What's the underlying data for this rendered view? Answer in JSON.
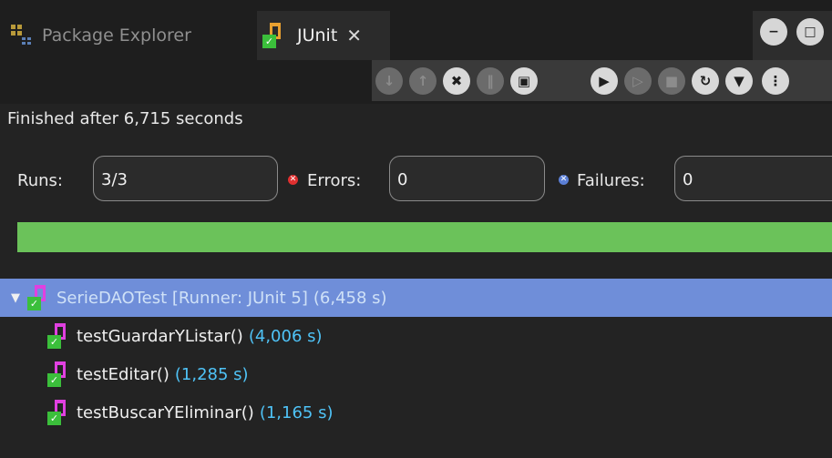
{
  "tabs": [
    {
      "label": "Package Explorer",
      "icon": "package-explorer-icon",
      "active": false
    },
    {
      "label": "JUnit",
      "icon": "junit-icon",
      "active": true,
      "close": "✕"
    }
  ],
  "window_controls": {
    "minimize": "−",
    "maximize": "□"
  },
  "toolbar": [
    {
      "name": "next-failure-icon",
      "glyph": "↓",
      "enabled": false
    },
    {
      "name": "previous-failure-icon",
      "glyph": "↑",
      "enabled": false
    },
    {
      "name": "show-failures-only-icon",
      "glyph": "✖",
      "enabled": true
    },
    {
      "name": "show-skipped-only-icon",
      "glyph": "‖",
      "enabled": false
    },
    {
      "name": "scroll-lock-icon",
      "glyph": "▣",
      "enabled": true
    },
    {
      "name": "rerun-test-icon",
      "glyph": "▶",
      "enabled": true
    },
    {
      "name": "rerun-failures-first-icon",
      "glyph": "▷",
      "enabled": false
    },
    {
      "name": "stop-test-icon",
      "glyph": "■",
      "enabled": false
    },
    {
      "name": "test-run-history-icon",
      "glyph": "↻",
      "enabled": true
    },
    {
      "name": "view-menu-icon",
      "glyph": "▼",
      "enabled": true
    },
    {
      "name": "more-options-icon",
      "glyph": "⋮",
      "enabled": true
    }
  ],
  "status": "Finished after 6,715 seconds",
  "counters": {
    "runs_label": "Runs:",
    "runs_value": "3/3",
    "errors_label": "Errors:",
    "errors_value": "0",
    "failures_label": "Failures:",
    "failures_value": "0"
  },
  "progress": 1.0,
  "colors": {
    "progress": "#6bc25a",
    "selection": "#6f8ed9",
    "time": "#4fc3f7"
  },
  "tree": {
    "root": {
      "name": "SerieDAOTest [Runner: JUnit 5]",
      "time": "(6,458 s)",
      "expanded": true
    },
    "children": [
      {
        "name": "testGuardarYListar()",
        "time": "(4,006 s)"
      },
      {
        "name": "testEditar()",
        "time": "(1,285 s)"
      },
      {
        "name": "testBuscarYEliminar()",
        "time": "(1,165 s)"
      }
    ]
  }
}
